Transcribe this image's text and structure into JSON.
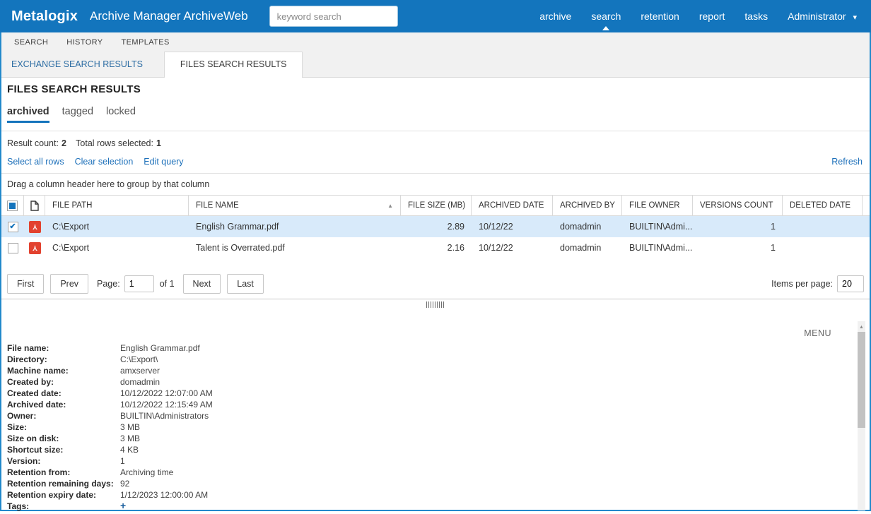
{
  "navbar": {
    "brand": "Metalogix",
    "app_title": "Archive Manager ArchiveWeb",
    "search_placeholder": "keyword search",
    "items": [
      {
        "label": "archive",
        "active": false
      },
      {
        "label": "search",
        "active": true
      },
      {
        "label": "retention",
        "active": false
      },
      {
        "label": "report",
        "active": false
      },
      {
        "label": "tasks",
        "active": false
      }
    ],
    "user_menu": "Administrator"
  },
  "subnav": {
    "items": [
      "SEARCH",
      "HISTORY",
      "TEMPLATES"
    ]
  },
  "tabs": [
    {
      "label": "EXCHANGE SEARCH RESULTS",
      "active": false
    },
    {
      "label": "FILES SEARCH RESULTS",
      "active": true
    }
  ],
  "page": {
    "title": "FILES SEARCH RESULTS",
    "subtabs": [
      {
        "label": "archived",
        "active": true
      },
      {
        "label": "tagged",
        "active": false
      },
      {
        "label": "locked",
        "active": false
      }
    ],
    "result_count_label": "Result count:",
    "result_count": "2",
    "selected_label": "Total rows selected:",
    "selected_count": "1",
    "action_select_all": "Select all rows",
    "action_clear": "Clear selection",
    "action_edit_query": "Edit query",
    "refresh_label": "Refresh"
  },
  "grid": {
    "group_hint": "Drag a column header here to group by that column",
    "columns": [
      "FILE PATH",
      "FILE NAME",
      "FILE SIZE (MB)",
      "ARCHIVED DATE",
      "ARCHIVED BY",
      "FILE OWNER",
      "VERSIONS COUNT",
      "DELETED DATE"
    ],
    "sort_column": "FILE NAME",
    "sort_direction": "ascending",
    "rows": [
      {
        "checked": true,
        "selected": true,
        "file_type": "pdf",
        "file_path": "C:\\Export",
        "file_name": "English Grammar.pdf",
        "file_size_mb": "2.89",
        "archived_date": "10/12/22",
        "archived_by": "domadmin",
        "file_owner": "BUILTIN\\Admi...",
        "versions_count": "1",
        "deleted_date": ""
      },
      {
        "checked": false,
        "selected": false,
        "file_type": "pdf",
        "file_path": "C:\\Export",
        "file_name": "Talent is Overrated.pdf",
        "file_size_mb": "2.16",
        "archived_date": "10/12/22",
        "archived_by": "domadmin",
        "file_owner": "BUILTIN\\Admi...",
        "versions_count": "1",
        "deleted_date": ""
      }
    ]
  },
  "pagination": {
    "first": "First",
    "prev": "Prev",
    "page_label": "Page:",
    "page_value": "1",
    "of_label": "of 1",
    "next": "Next",
    "last": "Last",
    "items_per_page_label": "Items per page:",
    "items_per_page_value": "20"
  },
  "details": {
    "menu_label": "MENU",
    "fields": [
      {
        "label": "File name:",
        "value": "English Grammar.pdf"
      },
      {
        "label": "Directory:",
        "value": "C:\\Export\\"
      },
      {
        "label": "Machine name:",
        "value": "amxserver"
      },
      {
        "label": "Created by:",
        "value": "domadmin"
      },
      {
        "label": "Created date:",
        "value": "10/12/2022 12:07:00 AM"
      },
      {
        "label": "Archived date:",
        "value": "10/12/2022 12:15:49 AM"
      },
      {
        "label": "Owner:",
        "value": "BUILTIN\\Administrators"
      },
      {
        "label": "Size:",
        "value": "3 MB"
      },
      {
        "label": "Size on disk:",
        "value": "3 MB"
      },
      {
        "label": "Shortcut size:",
        "value": "4 KB"
      },
      {
        "label": "Version:",
        "value": "1"
      },
      {
        "label": "Retention from:",
        "value": "Archiving time"
      },
      {
        "label": "Retention remaining days:",
        "value": "92"
      },
      {
        "label": "Retention expiry date:",
        "value": "1/12/2023 12:00:00 AM"
      }
    ],
    "tags_label": "Tags:",
    "tags_add_label": "+"
  },
  "colors": {
    "navbar_blue": "#1375bd",
    "accent_blue": "#1574bc",
    "link_blue": "#1d70ba",
    "selected_row": "#d8eafa",
    "page_border": "#2289cb",
    "pdf_red": "#e2422f"
  }
}
